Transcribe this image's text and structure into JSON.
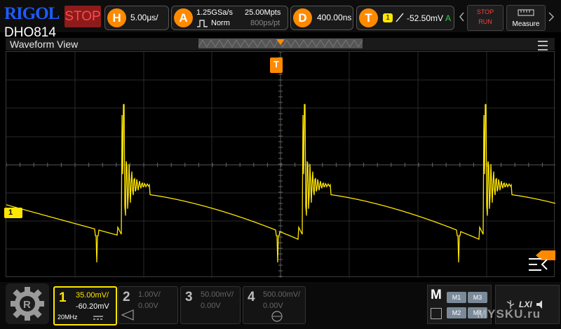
{
  "brand": "RIGOL",
  "model": "DHO814",
  "run_state": "STOP",
  "horizontal": {
    "icon": "H",
    "scale": "5.00μs/"
  },
  "acquire": {
    "icon": "A",
    "sample_rate": "1.25GSa/s",
    "mode": "Norm",
    "memory_depth": "25.00Mpts",
    "resolution": "800ps/pt"
  },
  "delay": {
    "icon": "D",
    "value": "400.00ns"
  },
  "trigger": {
    "icon": "T",
    "source": "1",
    "level": "-52.50mV",
    "mode": "A"
  },
  "buttons": {
    "stop_run_top": "STOP",
    "stop_run_bottom": "RUN",
    "measure": "Measure"
  },
  "window": {
    "title": "Waveform View",
    "trigger_marker": "T"
  },
  "ch1_marker": "1",
  "channels": [
    {
      "num": "1",
      "scale": "35.00mV/",
      "offset": "-60.20mV",
      "bw": "20MHz",
      "active": true
    },
    {
      "num": "2",
      "scale": "1.00V/",
      "offset": "0.00V",
      "active": false
    },
    {
      "num": "3",
      "scale": "50.00mV/",
      "offset": "0.00V",
      "active": false
    },
    {
      "num": "4",
      "scale": "500.00mV/",
      "offset": "0.00V",
      "active": false
    }
  ],
  "math": {
    "label": "M",
    "cells": [
      "M1",
      "M3",
      "M2",
      "M4"
    ]
  },
  "status": {
    "lxi": "LXI"
  },
  "watermark": "MYSKU.ru",
  "colors": {
    "ch1": "#ffe600",
    "accent": "#ff8a00",
    "stop": "#ff3b3b"
  }
}
